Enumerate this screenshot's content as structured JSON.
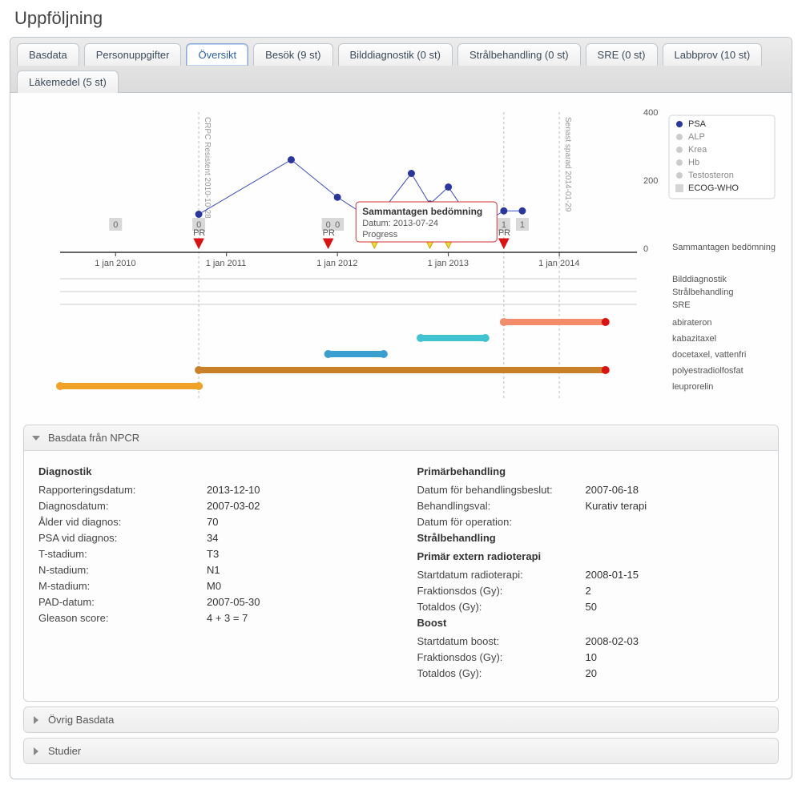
{
  "page_title": "Uppföljning",
  "tabs": [
    {
      "label": "Basdata"
    },
    {
      "label": "Personuppgifter"
    },
    {
      "label": "Översikt",
      "active": true
    },
    {
      "label": "Besök (9 st)"
    },
    {
      "label": "Bilddiagnostik (0 st)"
    },
    {
      "label": "Strålbehandling (0 st)"
    },
    {
      "label": "SRE (0 st)"
    },
    {
      "label": "Labbprov (10 st)"
    },
    {
      "label": "Läkemedel (5 st)"
    }
  ],
  "chart_data": {
    "type": "line",
    "x_axis_ticks": [
      "1 jan 2010",
      "1 jan 2011",
      "1 jan 2012",
      "1 jan 2013",
      "1 jan 2014"
    ],
    "y_axis_ticks": [
      0,
      200,
      400
    ],
    "ylim": [
      0,
      400
    ],
    "legend": [
      {
        "name": "PSA",
        "active": true,
        "color": "#2a369d",
        "marker": "dot"
      },
      {
        "name": "ALP",
        "active": false,
        "color": "#bbb",
        "marker": "dot"
      },
      {
        "name": "Krea",
        "active": false,
        "color": "#bbb",
        "marker": "dot"
      },
      {
        "name": "Hb",
        "active": false,
        "color": "#bbb",
        "marker": "dot"
      },
      {
        "name": "Testosteron",
        "active": false,
        "color": "#bbb",
        "marker": "dot"
      },
      {
        "name": "ECOG-WHO",
        "active": true,
        "color": "#d5d5d5",
        "marker": "square"
      }
    ],
    "series": [
      {
        "name": "PSA",
        "color": "#2a369d",
        "points": [
          {
            "x": "2010-10",
            "y": 100
          },
          {
            "x": "2011-08",
            "y": 260
          },
          {
            "x": "2012-01",
            "y": 150
          },
          {
            "x": "2012-05",
            "y": 80
          },
          {
            "x": "2012-09",
            "y": 220
          },
          {
            "x": "2012-11",
            "y": 130
          },
          {
            "x": "2013-01",
            "y": 180
          },
          {
            "x": "2013-04",
            "y": 60
          },
          {
            "x": "2013-07",
            "y": 110
          },
          {
            "x": "2013-09",
            "y": 110
          }
        ]
      }
    ],
    "ecog_points": [
      {
        "x": "2010-01",
        "v": "0"
      },
      {
        "x": "2010-10",
        "v": "0"
      },
      {
        "x": "2011-12",
        "v": "0"
      },
      {
        "x": "2012-01",
        "v": "0"
      },
      {
        "x": "2012-05",
        "v": "1"
      },
      {
        "x": "2012-09",
        "v": "1"
      },
      {
        "x": "2012-11",
        "v": "1"
      },
      {
        "x": "2013-01",
        "v": "1"
      },
      {
        "x": "2013-07",
        "v": "1"
      },
      {
        "x": "2013-09",
        "v": "1"
      }
    ],
    "assessment_markers": [
      {
        "x": "2010-10",
        "style": "red",
        "label": "PR"
      },
      {
        "x": "2011-12",
        "style": "red",
        "label": "PR"
      },
      {
        "x": "2012-05",
        "style": "yellow",
        "label": ""
      },
      {
        "x": "2012-11",
        "style": "yellow",
        "label": "R"
      },
      {
        "x": "2013-01",
        "style": "yellow",
        "label": "R"
      },
      {
        "x": "2013-07",
        "style": "red",
        "label": "PR"
      }
    ],
    "assessment_row_label": "Sammantagen bedömning",
    "vlines": [
      {
        "x": "2010-10",
        "label": "CRPC Resistent 2010-10-28"
      },
      {
        "x": "2013-07",
        "label": ""
      },
      {
        "x": "2014-01-29",
        "label": "Senast sparad 2014-01-29"
      }
    ],
    "lower_rows": [
      "Bilddiagnostik",
      "Strålbehandling",
      "SRE"
    ],
    "drug_bars": [
      {
        "name": "abirateron",
        "color": "#f28c6a",
        "from": "2013-07",
        "to": "2014-06",
        "end_dot": "#d11"
      },
      {
        "name": "kabazitaxel",
        "color": "#3fc3d1",
        "from": "2012-10",
        "to": "2013-05"
      },
      {
        "name": "docetaxel, vattenfri",
        "color": "#3b9ed1",
        "from": "2011-12",
        "to": "2012-06"
      },
      {
        "name": "polyestradiolfosfat",
        "color": "#c88129",
        "from": "2010-10",
        "to": "2014-06",
        "end_dot": "#d11"
      },
      {
        "name": "leuprorelin",
        "color": "#efa226",
        "from": "2009-07",
        "to": "2010-10"
      }
    ],
    "tooltip": {
      "title": "Sammantagen bedömning",
      "rows": [
        "Datum: 2013-07-24",
        "Progress"
      ]
    }
  },
  "accordions": [
    {
      "title": "Basdata från NPCR",
      "open": true,
      "left_title": "Diagnostik",
      "left": [
        {
          "k": "Rapporteringsdatum:",
          "v": "2013-12-10"
        },
        {
          "k": "Diagnosdatum:",
          "v": "2007-03-02"
        },
        {
          "k": "Ålder vid diagnos:",
          "v": "70"
        },
        {
          "k": "PSA vid diagnos:",
          "v": "34"
        },
        {
          "k": "T-stadium:",
          "v": "T3"
        },
        {
          "k": "N-stadium:",
          "v": "N1"
        },
        {
          "k": "M-stadium:",
          "v": "M0"
        },
        {
          "k": "PAD-datum:",
          "v": "2007-05-30"
        },
        {
          "k": "Gleason score:",
          "v": "4 + 3 = 7"
        }
      ],
      "right_groups": [
        {
          "title": "Primärbehandling",
          "rows": [
            {
              "k": "Datum för behandlingsbeslut:",
              "v": "2007-06-18"
            },
            {
              "k": "Behandlingsval:",
              "v": "Kurativ terapi"
            },
            {
              "k": "Datum för operation:",
              "v": ""
            }
          ]
        },
        {
          "title": "Strålbehandling",
          "subtitle": "Primär extern radioterapi",
          "rows": [
            {
              "k": "Startdatum radioterapi:",
              "v": "2008-01-15"
            },
            {
              "k": "Fraktionsdos (Gy):",
              "v": "2"
            },
            {
              "k": "Totaldos (Gy):",
              "v": "50"
            }
          ]
        },
        {
          "title": "Boost",
          "rows": [
            {
              "k": "Startdatum boost:",
              "v": "2008-02-03"
            },
            {
              "k": "Fraktionsdos (Gy):",
              "v": "10"
            },
            {
              "k": "Totaldos (Gy):",
              "v": "20"
            }
          ]
        }
      ]
    },
    {
      "title": "Övrig Basdata",
      "open": false
    },
    {
      "title": "Studier",
      "open": false
    }
  ]
}
